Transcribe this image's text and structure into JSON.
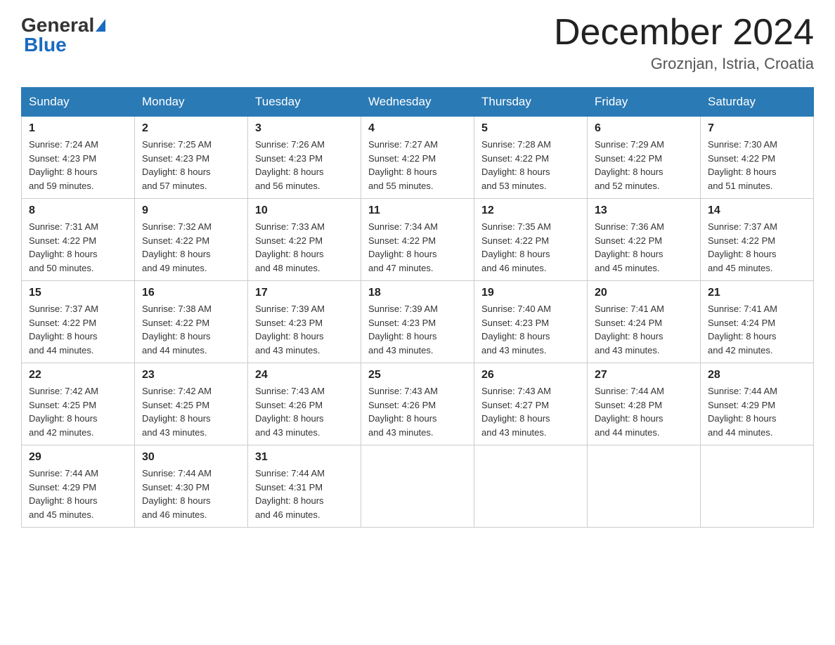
{
  "header": {
    "logo_general": "General",
    "logo_blue": "Blue",
    "month_title": "December 2024",
    "location": "Groznjan, Istria, Croatia"
  },
  "days_of_week": [
    "Sunday",
    "Monday",
    "Tuesday",
    "Wednesday",
    "Thursday",
    "Friday",
    "Saturday"
  ],
  "weeks": [
    [
      {
        "day": "1",
        "sunrise": "7:24 AM",
        "sunset": "4:23 PM",
        "daylight": "8 hours and 59 minutes."
      },
      {
        "day": "2",
        "sunrise": "7:25 AM",
        "sunset": "4:23 PM",
        "daylight": "8 hours and 57 minutes."
      },
      {
        "day": "3",
        "sunrise": "7:26 AM",
        "sunset": "4:23 PM",
        "daylight": "8 hours and 56 minutes."
      },
      {
        "day": "4",
        "sunrise": "7:27 AM",
        "sunset": "4:22 PM",
        "daylight": "8 hours and 55 minutes."
      },
      {
        "day": "5",
        "sunrise": "7:28 AM",
        "sunset": "4:22 PM",
        "daylight": "8 hours and 53 minutes."
      },
      {
        "day": "6",
        "sunrise": "7:29 AM",
        "sunset": "4:22 PM",
        "daylight": "8 hours and 52 minutes."
      },
      {
        "day": "7",
        "sunrise": "7:30 AM",
        "sunset": "4:22 PM",
        "daylight": "8 hours and 51 minutes."
      }
    ],
    [
      {
        "day": "8",
        "sunrise": "7:31 AM",
        "sunset": "4:22 PM",
        "daylight": "8 hours and 50 minutes."
      },
      {
        "day": "9",
        "sunrise": "7:32 AM",
        "sunset": "4:22 PM",
        "daylight": "8 hours and 49 minutes."
      },
      {
        "day": "10",
        "sunrise": "7:33 AM",
        "sunset": "4:22 PM",
        "daylight": "8 hours and 48 minutes."
      },
      {
        "day": "11",
        "sunrise": "7:34 AM",
        "sunset": "4:22 PM",
        "daylight": "8 hours and 47 minutes."
      },
      {
        "day": "12",
        "sunrise": "7:35 AM",
        "sunset": "4:22 PM",
        "daylight": "8 hours and 46 minutes."
      },
      {
        "day": "13",
        "sunrise": "7:36 AM",
        "sunset": "4:22 PM",
        "daylight": "8 hours and 45 minutes."
      },
      {
        "day": "14",
        "sunrise": "7:37 AM",
        "sunset": "4:22 PM",
        "daylight": "8 hours and 45 minutes."
      }
    ],
    [
      {
        "day": "15",
        "sunrise": "7:37 AM",
        "sunset": "4:22 PM",
        "daylight": "8 hours and 44 minutes."
      },
      {
        "day": "16",
        "sunrise": "7:38 AM",
        "sunset": "4:22 PM",
        "daylight": "8 hours and 44 minutes."
      },
      {
        "day": "17",
        "sunrise": "7:39 AM",
        "sunset": "4:23 PM",
        "daylight": "8 hours and 43 minutes."
      },
      {
        "day": "18",
        "sunrise": "7:39 AM",
        "sunset": "4:23 PM",
        "daylight": "8 hours and 43 minutes."
      },
      {
        "day": "19",
        "sunrise": "7:40 AM",
        "sunset": "4:23 PM",
        "daylight": "8 hours and 43 minutes."
      },
      {
        "day": "20",
        "sunrise": "7:41 AM",
        "sunset": "4:24 PM",
        "daylight": "8 hours and 43 minutes."
      },
      {
        "day": "21",
        "sunrise": "7:41 AM",
        "sunset": "4:24 PM",
        "daylight": "8 hours and 42 minutes."
      }
    ],
    [
      {
        "day": "22",
        "sunrise": "7:42 AM",
        "sunset": "4:25 PM",
        "daylight": "8 hours and 42 minutes."
      },
      {
        "day": "23",
        "sunrise": "7:42 AM",
        "sunset": "4:25 PM",
        "daylight": "8 hours and 43 minutes."
      },
      {
        "day": "24",
        "sunrise": "7:43 AM",
        "sunset": "4:26 PM",
        "daylight": "8 hours and 43 minutes."
      },
      {
        "day": "25",
        "sunrise": "7:43 AM",
        "sunset": "4:26 PM",
        "daylight": "8 hours and 43 minutes."
      },
      {
        "day": "26",
        "sunrise": "7:43 AM",
        "sunset": "4:27 PM",
        "daylight": "8 hours and 43 minutes."
      },
      {
        "day": "27",
        "sunrise": "7:44 AM",
        "sunset": "4:28 PM",
        "daylight": "8 hours and 44 minutes."
      },
      {
        "day": "28",
        "sunrise": "7:44 AM",
        "sunset": "4:29 PM",
        "daylight": "8 hours and 44 minutes."
      }
    ],
    [
      {
        "day": "29",
        "sunrise": "7:44 AM",
        "sunset": "4:29 PM",
        "daylight": "8 hours and 45 minutes."
      },
      {
        "day": "30",
        "sunrise": "7:44 AM",
        "sunset": "4:30 PM",
        "daylight": "8 hours and 46 minutes."
      },
      {
        "day": "31",
        "sunrise": "7:44 AM",
        "sunset": "4:31 PM",
        "daylight": "8 hours and 46 minutes."
      },
      null,
      null,
      null,
      null
    ]
  ],
  "labels": {
    "sunrise": "Sunrise:",
    "sunset": "Sunset:",
    "daylight": "Daylight:"
  }
}
